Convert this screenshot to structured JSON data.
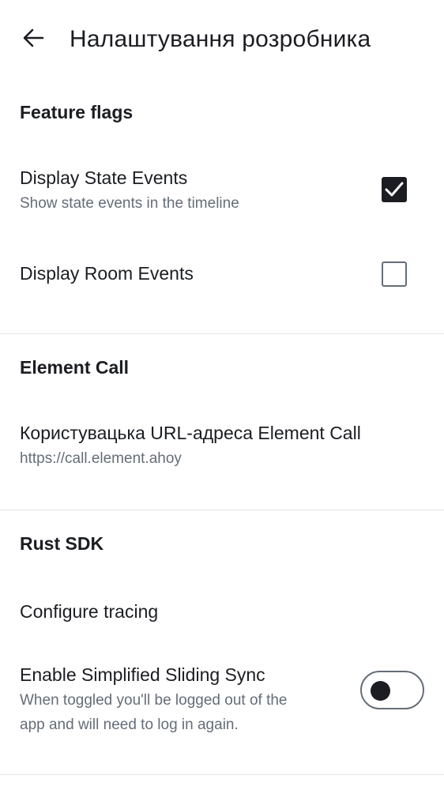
{
  "header": {
    "back_icon": "arrow-left-icon",
    "title": "Налаштування розробника"
  },
  "sections": {
    "feature_flags": {
      "title": "Feature flags",
      "display_state_events": {
        "title": "Display State Events",
        "subtitle": "Show state events in the timeline",
        "checked": true
      },
      "display_room_events": {
        "title": "Display Room Events",
        "checked": false
      }
    },
    "element_call": {
      "title": "Element Call",
      "custom_url": {
        "title": "Користувацька URL-адреса Element Call",
        "value": "https://call.element.ahoy"
      }
    },
    "rust_sdk": {
      "title": "Rust SDK",
      "configure_tracing": {
        "title": "Configure tracing"
      },
      "simplified_sliding_sync": {
        "title": "Enable Simplified Sliding Sync",
        "subtitle_line1": "When toggled you'll be logged out of the",
        "subtitle_line2": "app and will need to log in again.",
        "enabled": false
      }
    }
  },
  "colors": {
    "text_primary": "#1b1d22",
    "text_secondary": "#656d77",
    "divider": "#e4e6ea",
    "background": "#ffffff"
  }
}
